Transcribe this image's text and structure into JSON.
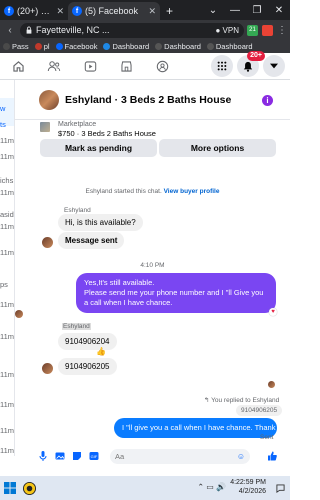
{
  "browser": {
    "tabs": [
      {
        "title": "(20+) Messenger | Faceboo",
        "active": false,
        "color": "#0866ff"
      },
      {
        "title": "(5) Facebook",
        "active": true,
        "color": "#0866ff"
      }
    ],
    "address": "Fayetteville, NC ...",
    "vpn_label": "VPN",
    "bookmarks": [
      {
        "label": "Pass",
        "color": "#4a4a4a"
      },
      {
        "label": "pl",
        "color": "#c0392b"
      },
      {
        "label": "Facebook",
        "color": "#0866ff"
      },
      {
        "label": "Dashboard",
        "color": "#1e88e5"
      },
      {
        "label": "Dashboard",
        "color": "#555"
      },
      {
        "label": "Dashboard",
        "color": "#555"
      }
    ]
  },
  "fb": {
    "notif_badge": "20+"
  },
  "sidebar": {
    "items": [
      "w",
      "ts",
      "11m",
      "11m",
      "11m",
      "ichs...",
      "aside",
      "11m",
      "11m",
      "ps",
      "11m",
      "11m",
      "11m",
      "11m",
      "11m",
      "11m"
    ]
  },
  "chat": {
    "title": "Eshyland · 3 Beds 2 Baths House",
    "marketplace_label": "Marketplace",
    "listing": "$750 · 3 Beds 2 Baths House",
    "pending_btn": "Mark as pending",
    "more_btn": "More options",
    "started_text": "Eshyland started this chat.",
    "buyer_profile": "View buyer profile",
    "sender_name": "Eshyland",
    "msg1": "Hi, is this available?",
    "msg2": "Message sent",
    "time1": "4:10 PM",
    "out_line1": "Yes,It's still available.",
    "out_line2": "Please send me your phone number and I \"ll Give you a call when I have chance.",
    "sender_name2": "Eshyland",
    "msg3": "9104906204",
    "msg4": "9104906205",
    "replied_note": "You replied to Eshyland",
    "quoted": "9104906205",
    "reply": "I \"ll give you a call when I have chance. Thank you.",
    "sent": "Sent",
    "composer_placeholder": "Aa"
  },
  "taskbar": {
    "time": "4:22:59 PM",
    "date": "4/2/2026"
  }
}
